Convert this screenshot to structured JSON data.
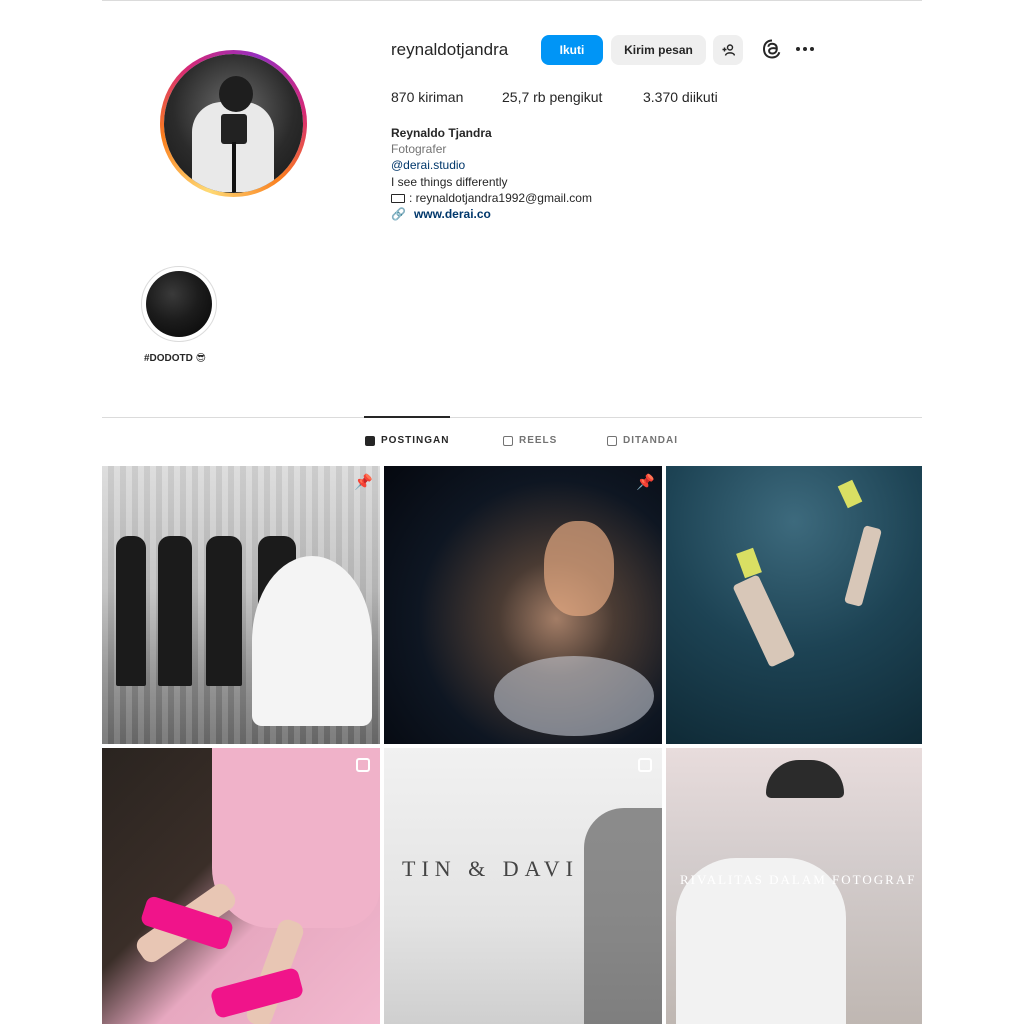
{
  "profile": {
    "username": "reynaldotjandra",
    "stats": {
      "posts": "870 kiriman",
      "followers": "25,7 rb pengikut",
      "following": "3.370 diikuti"
    },
    "bio": {
      "name": "Reynaldo Tjandra",
      "category": "Fotografer",
      "handle": "@derai.studio",
      "line": "I see things differently",
      "email": ": reynaldotjandra1992@gmail.com",
      "link": "www.derai.co"
    }
  },
  "actions": {
    "follow_label": "Ikuti",
    "message_label": "Kirim pesan",
    "suggest_label": "+👤"
  },
  "highlights": [
    {
      "label": "#DODOTD 😎"
    }
  ],
  "tabs": [
    {
      "label": "POSTINGAN",
      "active": true,
      "icon": "grid-icon"
    },
    {
      "label": "REELS",
      "active": false,
      "icon": "reels-icon"
    },
    {
      "label": "DITANDAI",
      "active": false,
      "icon": "tagged-icon"
    }
  ],
  "posts": [
    {
      "badge": "pin-icon"
    },
    {
      "badge": "pin-icon"
    },
    {
      "badge": "pin-icon"
    },
    {
      "badge": "multi-icon"
    },
    {
      "badge": "multi-icon",
      "text": "TIN & DAVI"
    },
    {
      "badge": "multi-icon",
      "text": "RIVALITAS DALAM FOTOGRAF"
    }
  ],
  "colors": {
    "accent": "#0095f6",
    "text": "#262626",
    "muted": "#737373",
    "link": "#00376b"
  }
}
